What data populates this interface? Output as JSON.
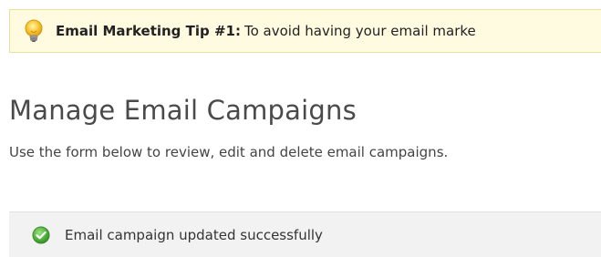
{
  "tip": {
    "icon": "lightbulb-icon",
    "title": "Email Marketing Tip #1:",
    "text": "To avoid having your email marke"
  },
  "page": {
    "title": "Manage Email Campaigns",
    "subtitle": "Use the form below to review, edit and delete email campaigns."
  },
  "status": {
    "icon": "check-circle-icon",
    "message": "Email campaign updated successfully",
    "color": "#5cb85c"
  },
  "colors": {
    "tip_background": "#fffbe0",
    "tip_border": "#e9dfa0",
    "status_background": "#f2f2f2"
  }
}
